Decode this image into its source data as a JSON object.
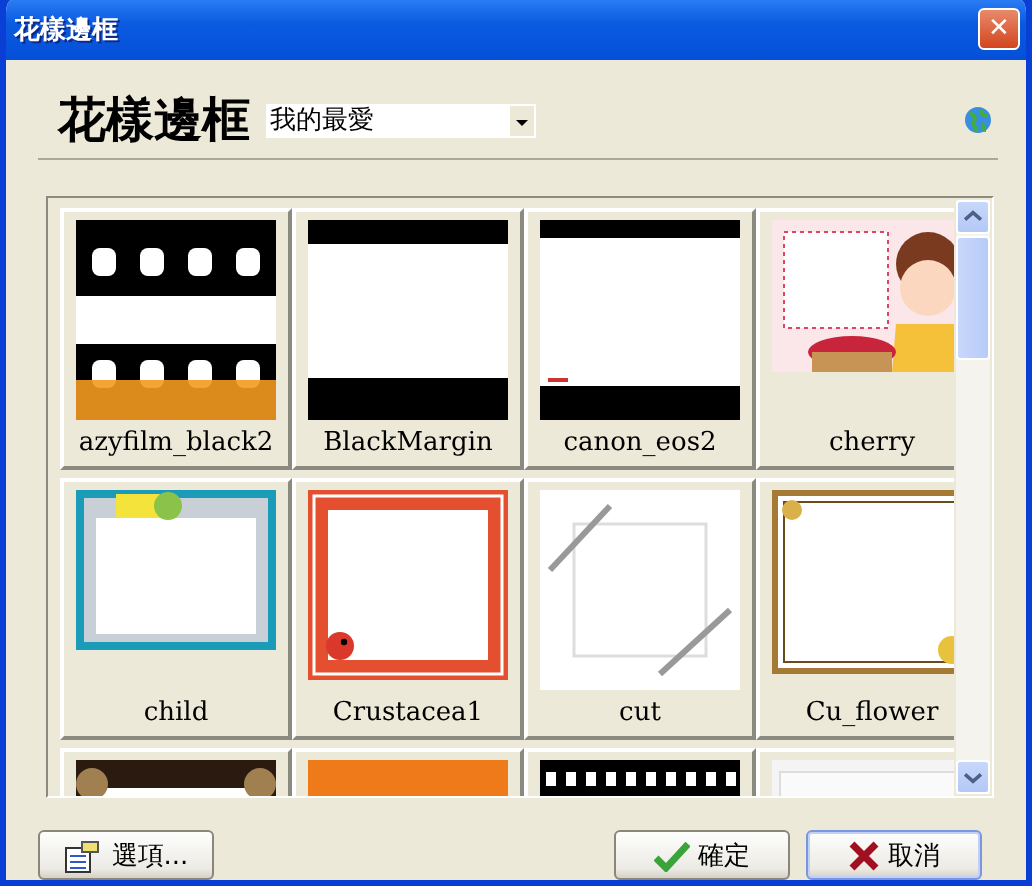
{
  "window": {
    "title": "花樣邊框",
    "close": "✕"
  },
  "header": {
    "title": "花樣邊框",
    "category": {
      "value": "我的最愛"
    }
  },
  "frames": [
    {
      "kind": "picture",
      "name": "azyfilm_black2"
    },
    {
      "kind": "picture",
      "name": "BlackMargin"
    },
    {
      "kind": "picture",
      "name": "canon_eos2"
    },
    {
      "kind": "picture",
      "name": "cherry"
    },
    {
      "kind": "picture",
      "name": "child"
    },
    {
      "kind": "picture",
      "name": "Crustacea1"
    },
    {
      "kind": "picture",
      "name": "cut"
    },
    {
      "kind": "picture",
      "name": "Cu_flower"
    },
    {
      "kind": "picture"
    },
    {
      "kind": "picture"
    },
    {
      "kind": "picture"
    },
    {
      "kind": "picture"
    }
  ],
  "buttons": [
    {
      "kind": "options",
      "label": "選項..."
    },
    {
      "kind": "ok",
      "label": "確定"
    },
    {
      "kind": "cancel",
      "label": "取消"
    }
  ]
}
